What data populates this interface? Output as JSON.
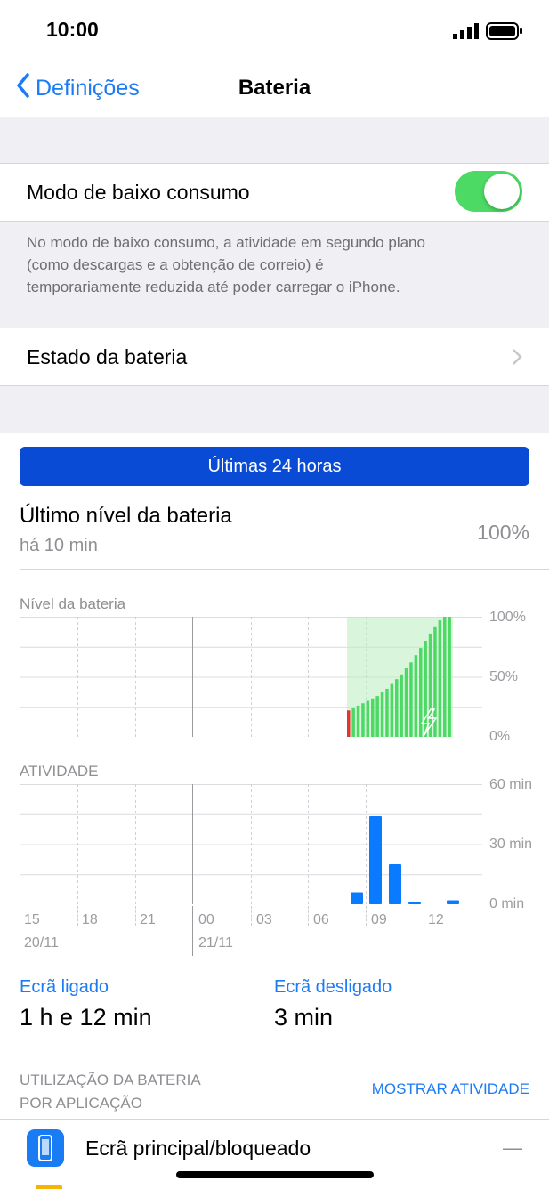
{
  "status_bar": {
    "time": "10:00"
  },
  "nav": {
    "back_label": "Definições",
    "title": "Bateria"
  },
  "low_power": {
    "label": "Modo de baixo consumo",
    "enabled": true,
    "footnote_lines": [
      "No modo de baixo consumo, a atividade em segundo plano",
      "(como descargas e a obtenção de correio) é",
      "temporariamente reduzida até poder carregar o iPhone."
    ]
  },
  "battery_health": {
    "label": "Estado da bateria"
  },
  "segment": {
    "label": "Últimas 24 horas"
  },
  "last_level": {
    "title": "Último nível da bateria",
    "subtitle": "há 10 min",
    "value": "100%"
  },
  "chart_data": [
    {
      "type": "bar",
      "title": "Nível da bateria",
      "y_ticks": [
        "100%",
        "50%",
        "0%"
      ],
      "ylim": [
        0,
        100
      ],
      "values": [
        22,
        24,
        26,
        28,
        30,
        32,
        34,
        37,
        40,
        44,
        48,
        52,
        57,
        62,
        68,
        74,
        80,
        86,
        92,
        97,
        100,
        100
      ],
      "low_value": 22,
      "colors": {
        "normal": "#4cd964",
        "low": "#e5342e",
        "charging": "#b9ecbd"
      }
    },
    {
      "type": "bar",
      "title": "ATIVIDADE",
      "y_ticks": [
        "60 min",
        "30 min",
        "0 min"
      ],
      "ylim": [
        0,
        60
      ],
      "x_ticks": [
        "15",
        "18",
        "21",
        "00",
        "03",
        "06",
        "09",
        "12"
      ],
      "date_labels": [
        "20/11",
        "21/11"
      ],
      "values": [
        6,
        44,
        20,
        1,
        2
      ],
      "color": "#0a7bff"
    }
  ],
  "screen_time": {
    "on_label": "Ecrã ligado",
    "on_value": "1 h e 12 min",
    "off_label": "Ecrã desligado",
    "off_value": "3 min"
  },
  "usage": {
    "header_line1": "UTILIZAÇÃO DA BATERIA",
    "header_line2": "POR APLICAÇÃO",
    "show_activity": "MOSTRAR ATIVIDADE",
    "apps": [
      {
        "name": "Ecrã principal/bloqueado",
        "value": "—",
        "icon": "home-screen-icon"
      }
    ]
  }
}
